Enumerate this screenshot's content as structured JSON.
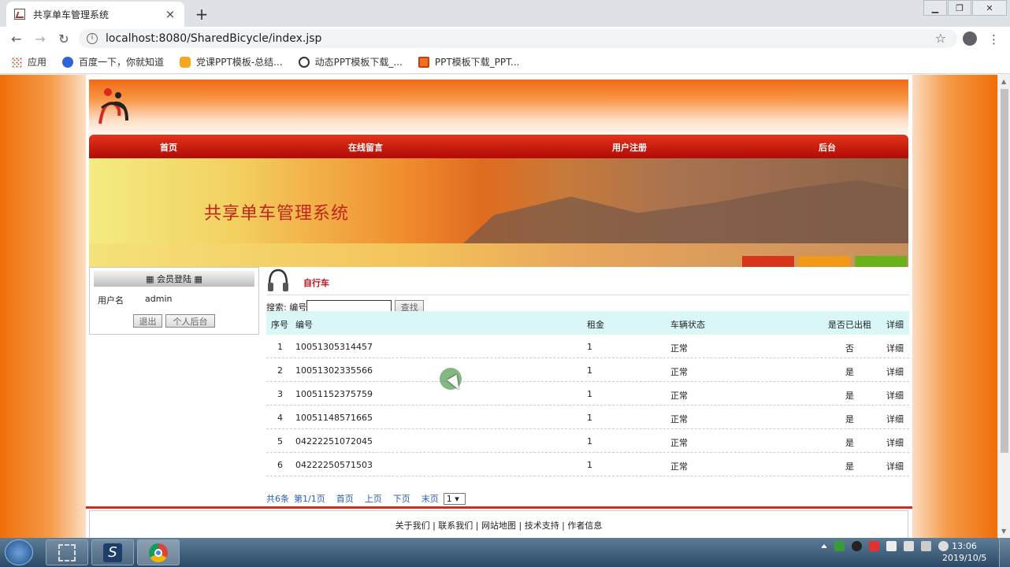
{
  "browser": {
    "tab_title": "共享单车管理系统",
    "tab_close": "×",
    "new_tab": "+",
    "url": "localhost:8080/SharedBicycle/index.jsp",
    "bookmarks": [
      "应用",
      "百度一下，你就知道",
      "党课PPT模板-总结...",
      "动态PPT模板下载_...",
      "PPT模板下载_PPT..."
    ]
  },
  "site": {
    "nav": [
      "首页",
      "在线留言",
      "用户注册",
      "后台"
    ],
    "banner_title": "共享单车管理系统",
    "login": {
      "header": "▦ 会员登陆 ▦",
      "user_label": "用户名",
      "user_value": "admin",
      "logout_btn": "退出",
      "backend_btn": "个人后台"
    },
    "section_title": "自行车",
    "search": {
      "label": "搜索: 编号",
      "value": "",
      "button": "查找"
    },
    "table": {
      "headers": [
        "序号",
        "编号",
        "租金",
        "车辆状态",
        "是否已出租",
        "详细"
      ],
      "rows": [
        [
          "1",
          "10051305314457",
          "1",
          "正常",
          "否",
          "详细"
        ],
        [
          "2",
          "10051302335566",
          "1",
          "正常",
          "是",
          "详细"
        ],
        [
          "3",
          "10051152375759",
          "1",
          "正常",
          "是",
          "详细"
        ],
        [
          "4",
          "10051148571665",
          "1",
          "正常",
          "是",
          "详细"
        ],
        [
          "5",
          "04222251072045",
          "1",
          "正常",
          "是",
          "详细"
        ],
        [
          "6",
          "04222250571503",
          "1",
          "正常",
          "是",
          "详细"
        ]
      ]
    },
    "pager": {
      "total": "共6条",
      "page_info": "第1/1页",
      "first": "首页",
      "prev": "上页",
      "next": "下页",
      "last": "末页",
      "page_select": "1 ▾"
    },
    "footer": "关于我们 | 联系我们 | 网站地图 | 技术支持 | 作者信息"
  },
  "taskbar": {
    "time": "13:06",
    "date": "2019/10/5"
  },
  "colors": {
    "nav_red": "#c8150d",
    "accent_orange": "#f26a12",
    "table_header_bg": "#d9f7f6",
    "link_blue": "#2a5db0",
    "title_red": "#c1121b"
  }
}
